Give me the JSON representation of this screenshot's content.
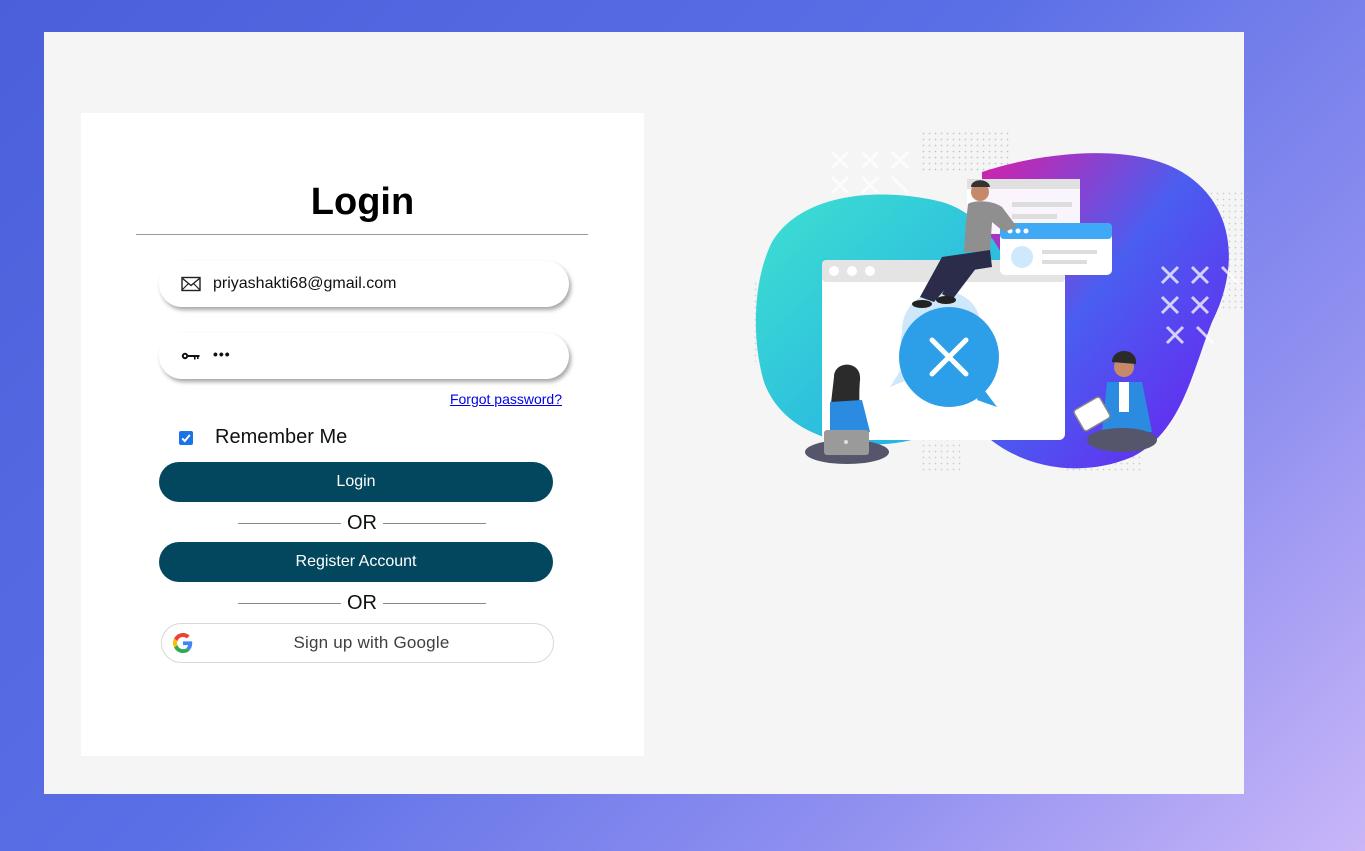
{
  "login": {
    "title": "Login",
    "email_value": "priyashakti68@gmail.com",
    "password_value": "•••",
    "forgot_label": "Forgot password?",
    "remember_label": "Remember Me",
    "remember_checked": true,
    "login_button": "Login",
    "or_label": "OR",
    "register_button": "Register Account",
    "google_button": "Sign up with Google"
  },
  "icons": {
    "email": "envelope-icon",
    "password": "key-icon",
    "google": "google-g-icon"
  },
  "colors": {
    "button_bg": "#02475e",
    "link": "#0000ee",
    "checkbox": "#1a73e8",
    "panel_bg": "#f5f5f5"
  }
}
